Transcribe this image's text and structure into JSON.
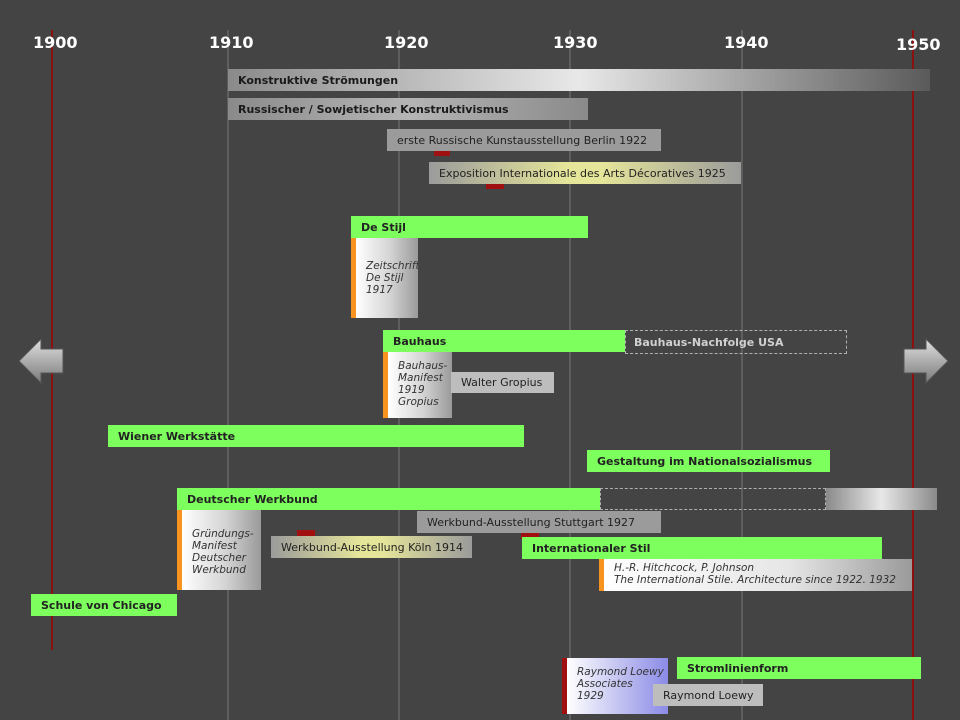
{
  "years": [
    "1900",
    "1910",
    "1920",
    "1930",
    "1940",
    "1950"
  ],
  "movements": {
    "konstruktive": "Konstruktive Strömungen",
    "russischer": "Russischer / Sowjetischer Konstruktivismus",
    "de_stijl": "De Stijl",
    "bauhaus": "Bauhaus",
    "bauhaus_usa": "Bauhaus-Nachfolge USA",
    "wiener": "Wiener Werkstätte",
    "ns": "Gestaltung im Nationalsozialismus",
    "werkbund": "Deutscher Werkbund",
    "international": "Internationaler Stil",
    "chicago": "Schule von Chicago",
    "stromlinie": "Stromlinienform"
  },
  "events": {
    "russische_ausstellung": "erste Russische Kunstausstellung Berlin 1922",
    "exposition": "Exposition Internationale des Arts Décoratives 1925",
    "werkbund_stuttgart": "Werkbund-Ausstellung Stuttgart 1927",
    "werkbund_koeln": "Werkbund-Ausstellung Köln 1914",
    "gropius": "Walter Gropius",
    "loewy": "Raymond Loewy"
  },
  "cards": {
    "de_stijl": "Zeitschrift\nDe Stijl\n1917",
    "bauhaus": "Bauhaus-\nManifest\n1919\nGropius",
    "werkbund": "Gründungs-\nManifest\nDeutscher\nWerkbund",
    "international": "H.-R. Hitchcock, P. Johnson\nThe International Stile. Architecture since 1922. 1932",
    "loewy": "Raymond Loewy\nAssociates\n1929"
  },
  "colors": {
    "background": "#444444",
    "movement": "#7dff5e",
    "marker": "#a01010",
    "card_accent": "#f7931e"
  }
}
